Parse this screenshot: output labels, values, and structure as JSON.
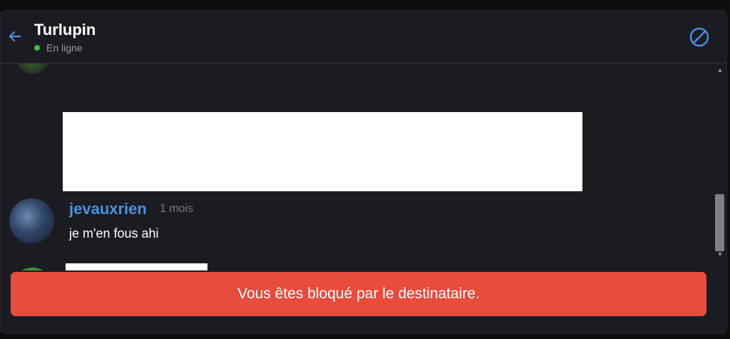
{
  "header": {
    "title": "Turlupin",
    "status": "En ligne",
    "status_color": "#3fbf4a",
    "back_icon": "arrow-left-icon",
    "block_icon": "block-icon"
  },
  "messages": [
    {
      "username": "jevauxrien",
      "time": "1 mois",
      "text": "je m'en fous ahi"
    }
  ],
  "banner": {
    "text": "Vous êtes bloqué par le destinataire.",
    "color": "#e84c3d"
  },
  "colors": {
    "accent": "#4a90e2",
    "background": "#1b1c21"
  }
}
